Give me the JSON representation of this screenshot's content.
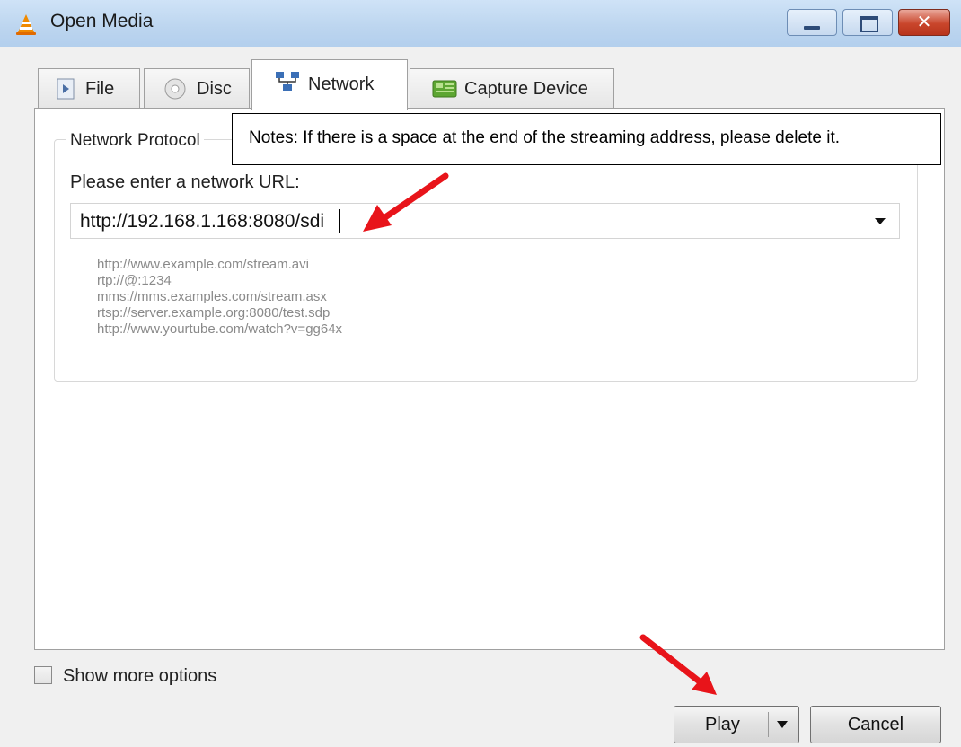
{
  "window": {
    "title": "Open Media",
    "app_icon": "vlc-cone-icon"
  },
  "tabs": [
    {
      "label": "File",
      "icon": "file-icon"
    },
    {
      "label": "Disc",
      "icon": "disc-icon"
    },
    {
      "label": "Network",
      "icon": "network-icon",
      "active": true
    },
    {
      "label": "Capture Device",
      "icon": "capture-device-icon"
    }
  ],
  "network": {
    "group_title": "Network Protocol",
    "url_prompt": "Please enter a network URL:",
    "url_value": "http://192.168.1.168:8080/sdi",
    "examples": [
      "http://www.example.com/stream.avi",
      "rtp://@:1234",
      "mms://mms.examples.com/stream.asx",
      "rtsp://server.example.org:8080/test.sdp",
      "http://www.yourtube.com/watch?v=gg64x"
    ]
  },
  "note": "Notes: If there is a space at the end of the streaming address, please delete it.",
  "options": {
    "show_more_label": "Show more options",
    "show_more_checked": false
  },
  "buttons": {
    "play": "Play",
    "cancel": "Cancel"
  },
  "colors": {
    "annotation_arrow": "#e8141a",
    "titlebar": "#bcd5ef"
  }
}
